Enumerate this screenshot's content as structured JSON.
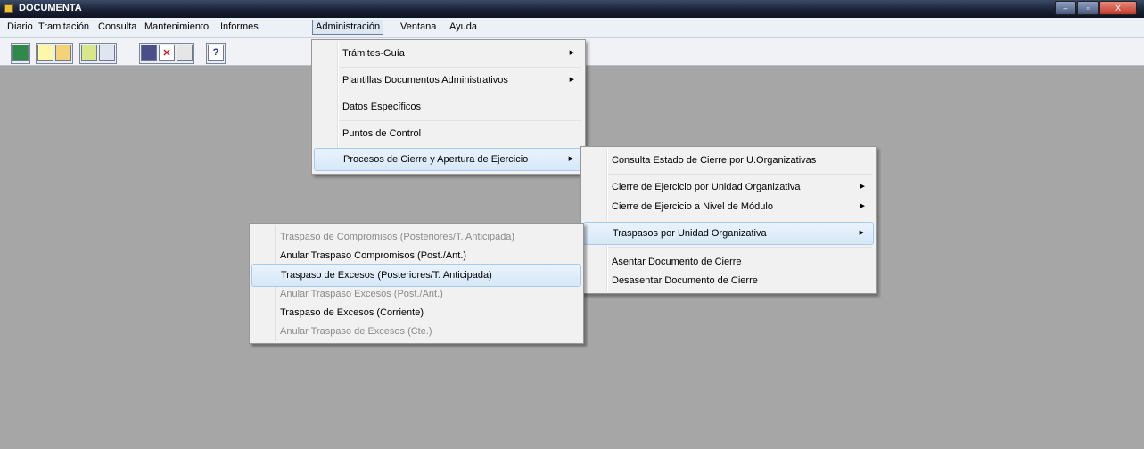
{
  "window": {
    "title": "DOCUMENTA",
    "min": "–",
    "max": "▫",
    "close": "X"
  },
  "menubar": [
    "Diario",
    "Tramitación",
    "Consulta",
    "Mantenimiento",
    "Informes",
    "Administración",
    "Ventana",
    "Ayuda"
  ],
  "toolbar": {
    "icons": [
      "exit-icon",
      "new-document-icon",
      "open-folder-icon",
      "tree-view-icon",
      "search-icon",
      "save-icon",
      "delete-icon",
      "refresh-icon",
      "help-icon"
    ],
    "help_label": "?",
    "delete_label": "✕"
  },
  "admin_menu": [
    {
      "label": "Trámites-Guía",
      "submenu": true
    },
    {
      "label": "Plantillas Documentos Administrativos",
      "submenu": true
    },
    {
      "label": "Datos Específicos",
      "submenu": false
    },
    {
      "label": "Puntos de Control",
      "submenu": false
    },
    {
      "label": "Procesos de Cierre y Apertura de Ejercicio",
      "submenu": true
    }
  ],
  "cierre_menu": [
    {
      "label": "Consulta Estado de Cierre por U.Organizativas",
      "submenu": false
    },
    {
      "label": "Cierre de Ejercicio por Unidad Organizativa",
      "submenu": true
    },
    {
      "label": "Cierre de Ejercicio a  Nivel de  Módulo",
      "submenu": true
    },
    {
      "label": "Traspasos por Unidad Organizativa",
      "submenu": true
    },
    {
      "label": "Asentar Documento de Cierre",
      "submenu": false
    },
    {
      "label": "Desasentar Documento de Cierre",
      "submenu": false
    }
  ],
  "traspasos_menu": [
    {
      "label": "Traspaso de Compromisos (Posteriores/T. Anticipada)",
      "enabled": false
    },
    {
      "label": "Anular Traspaso Compromisos (Post./Ant.)",
      "enabled": true
    },
    {
      "label": "Traspaso de Excesos (Posteriores/T. Anticipada)",
      "enabled": true
    },
    {
      "label": "Anular Traspaso Excesos (Post./Ant.)",
      "enabled": false
    },
    {
      "label": "Traspaso de Excesos (Corriente)",
      "enabled": true
    },
    {
      "label": "Anular Traspaso de Excesos (Cte.)",
      "enabled": false
    }
  ],
  "arrow": "▶",
  "colors": {
    "highlight": "#d6e8f8",
    "disabled_text": "#8a8a8a",
    "workspace": "#a6a6a6"
  }
}
